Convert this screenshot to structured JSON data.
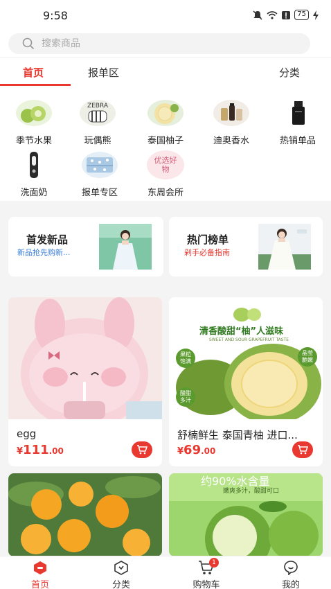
{
  "status_bar": {
    "time": "9:58",
    "battery": "75"
  },
  "search": {
    "placeholder": "搜索商品"
  },
  "tabs": [
    {
      "label": "首页",
      "active": true
    },
    {
      "label": "报单区",
      "active": false
    },
    {
      "label": "分类",
      "active": false
    }
  ],
  "categories": [
    {
      "label": "季节水果",
      "icon": "fruit-icon"
    },
    {
      "label": "玩偶熊",
      "icon": "zebra-toy-icon"
    },
    {
      "label": "泰国柚子",
      "icon": "pomelo-icon"
    },
    {
      "label": "迪奥香水",
      "icon": "perfume-icon"
    },
    {
      "label": "热销单品",
      "icon": "cosmetic-bottle-icon"
    },
    {
      "label": "洗面奶",
      "icon": "cleanser-icon"
    },
    {
      "label": "报单专区",
      "icon": "bedding-icon"
    },
    {
      "label": "东周会所",
      "icon": "youxuan-haowu-icon",
      "icon_text": "优选好物"
    }
  ],
  "promos": [
    {
      "title": "首发新品",
      "subtitle": "新品抢先购新...",
      "subtitle_color": "#3b7fd9"
    },
    {
      "title": "热门榜单",
      "subtitle": "剁手必备指南",
      "subtitle_color": "#e8382f"
    }
  ],
  "products": [
    {
      "name": "egg",
      "price_symbol": "¥",
      "price_int": "111",
      "price_dec": ".00"
    },
    {
      "name": "舒楠鲜生 泰国青柚 进口...",
      "price_symbol": "¥",
      "price_int": "69",
      "price_dec": ".00",
      "banner_title": "清香酸甜“柚”人滋味",
      "banner_sub": "SWEET AND SOUR GRAPEFRUIT TASTE",
      "tags": [
        "果粒饱满",
        "晶莹脆嫩",
        "酸甜多汁"
      ]
    },
    {
      "name": "",
      "price_symbol": "",
      "price_int": "",
      "price_dec": ""
    },
    {
      "name": "",
      "price_symbol": "",
      "price_int": "",
      "price_dec": "",
      "banner_title": "约90%水含量",
      "banner_sub": "嫩爽多汁，酸甜可口"
    }
  ],
  "bottom_nav": [
    {
      "label": "首页",
      "active": true
    },
    {
      "label": "分类",
      "active": false
    },
    {
      "label": "购物车",
      "active": false,
      "badge": "1"
    },
    {
      "label": "我的",
      "active": false
    }
  ],
  "colors": {
    "accent": "#e8382f",
    "background": "#f4f4f4"
  }
}
